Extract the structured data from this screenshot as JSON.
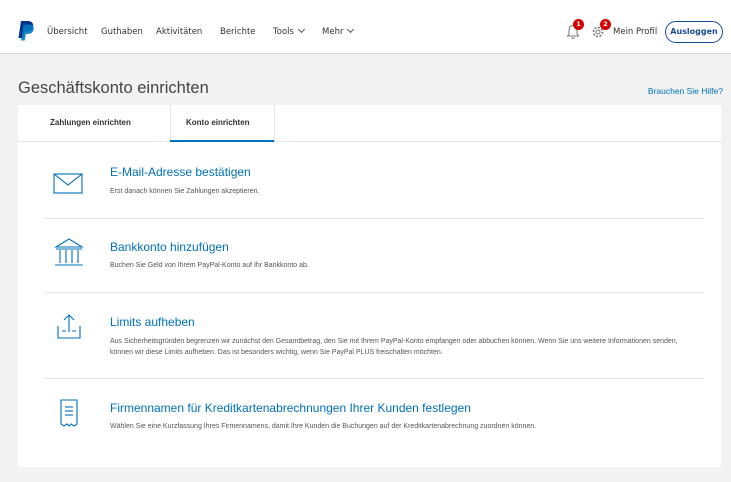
{
  "nav": {
    "items": [
      "Übersicht",
      "Guthaben",
      "Aktivitäten",
      "Berichte",
      "Tools",
      "Mehr"
    ],
    "notifications_count": "1",
    "settings_count": "2",
    "profile_label": "Mein Profil",
    "logout_label": "Ausloggen"
  },
  "page": {
    "title": "Geschäftskonto einrichten",
    "help_link": "Brauchen Sie Hilfe?"
  },
  "tabs": [
    {
      "label": "Zahlungen einrichten",
      "active": false
    },
    {
      "label": "Konto einrichten",
      "active": true
    }
  ],
  "tasks": [
    {
      "icon": "envelope-icon",
      "title": "E-Mail-Adresse bestätigen",
      "description": "Erst danach können Sie Zahlungen akzeptieren."
    },
    {
      "icon": "bank-icon",
      "title": "Bankkonto hinzufügen",
      "description": "Buchen Sie Geld von Ihrem PayPal-Konto auf Ihr Bankkonto ab."
    },
    {
      "icon": "upload-icon",
      "title": "Limits aufheben",
      "description": "Aus Sicherheitsgründen begrenzen wir zunächst den Gesamtbetrag, den Sie mit Ihrem PayPal-Konto empfangen oder abbuchen können. Wenn Sie uns weitere Informationen senden, können wir diese Limits aufheben. Das ist besonders wichtig, wenn Sie PayPal PLUS freischalten möchten."
    },
    {
      "icon": "receipt-icon",
      "title": "Firmennamen für Kreditkartenabrechnungen Ihrer Kunden festlegen",
      "description": "Wählen Sie eine Kurzfassung Ihres Firmennamens, damit Ihre Kunden die Buchungen auf der Kreditkartenabrechnung zuordnen können."
    }
  ],
  "colors": {
    "brand_blue": "#0070ba",
    "dark_blue": "#1a4c93",
    "badge_red": "#d20000"
  }
}
